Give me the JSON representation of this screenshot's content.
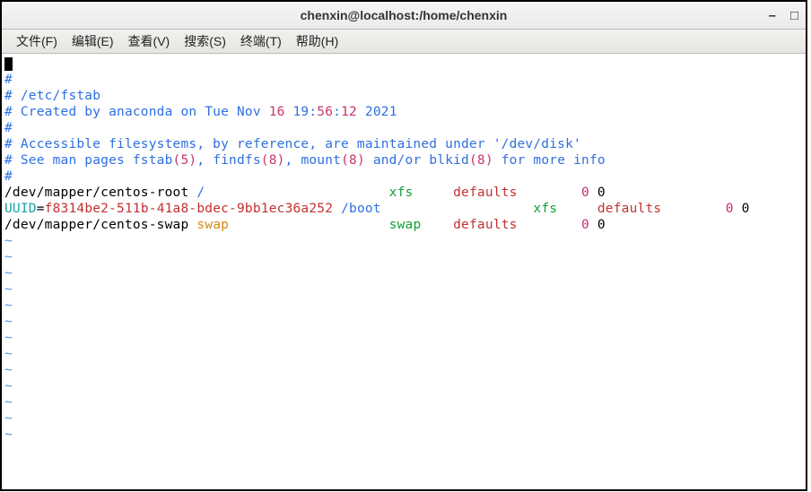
{
  "window": {
    "title": "chenxin@localhost:/home/chenxin",
    "minimize": "–",
    "maximize": "□"
  },
  "menu": {
    "file": "文件(F)",
    "edit": "编辑(E)",
    "view": "查看(V)",
    "search": "搜索(S)",
    "terminal": "终端(T)",
    "help": "帮助(H)"
  },
  "fstab": {
    "l1": "#",
    "l2": "# /etc/fstab",
    "l3a": "# Created by anaconda on Tue Nov ",
    "l3b": "16",
    "l3c": " 19",
    "l3d": ":",
    "l3e": "56",
    "l3f": ":",
    "l3g": "12",
    "l3h": " 2021",
    "l4": "#",
    "l5": "# Accessible filesystems, by reference, are maintained under '/dev/disk'",
    "l6a": "# See man pages fstab",
    "l6b": "(5)",
    "l6c": ", findfs",
    "l6d": "(8)",
    "l6e": ", mount",
    "l6f": "(8)",
    "l6g": " and/or blkid",
    "l6h": "(8)",
    "l6i": " for more info",
    "l7": "#",
    "row1": {
      "dev": "/dev/mapper/centos-root ",
      "mnt": "/                       ",
      "fs": "xfs     ",
      "opt": "defaults        ",
      "dump": "0",
      "pass": " 0"
    },
    "row2": {
      "pre": "UUID",
      "eq": "=",
      "uuid": "f8314be2-511b-41a8-bdec-9bb1ec36a252",
      "mnt": " /boot                   ",
      "fs": "xfs     ",
      "opt": "defaults        ",
      "dump": "0",
      "pass": " 0"
    },
    "row3": {
      "dev": "/dev/mapper/centos-swap ",
      "mnt": "swap                    ",
      "fs": "swap    ",
      "opt": "defaults        ",
      "dump": "0",
      "pass": " 0"
    },
    "tilde": "~"
  }
}
